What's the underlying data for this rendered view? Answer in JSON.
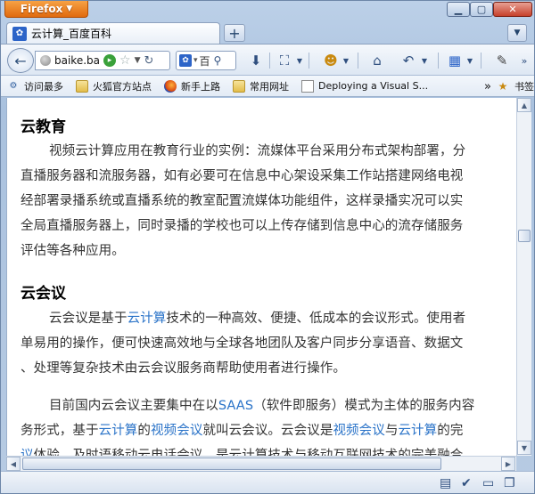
{
  "titlebar": {
    "app_button": "Firefox"
  },
  "tab": {
    "title": "云计算_百度百科",
    "favicon": "paw-icon"
  },
  "nav": {
    "url": "baike.ba",
    "search_text": "百"
  },
  "bookmarks": {
    "items": [
      "访问最多",
      "火狐官方站点",
      "新手上路",
      "常用网址",
      "Deploying a Visual S..."
    ],
    "more": "»",
    "bookmarks_label": "书签"
  },
  "content": {
    "section1": {
      "heading": "云教育",
      "lines": [
        "视频云计算应用在教育行业的实例：流媒体平台采用分布式架构部署，分",
        "直播服务器和流服务器，如有必要可在信息中心架设采集工作站搭建网络电视",
        "经部署录播系统或直播系统的教室配置流媒体功能组件，这样录播实况可以实",
        "全局直播服务器上，同时录播的学校也可以上传存储到信息中心的流存储服务",
        "评估等各种应用。"
      ]
    },
    "section2": {
      "heading": "云会议",
      "p1": {
        "l1_a": "云会议是基于",
        "l1_link": "云计算",
        "l1_b": "技术的一种高效、便捷、低成本的会议形式。使用者",
        "l2": "单易用的操作，便可快速高效地与全球各地团队及客户同步分享语音、数据文",
        "l3": "、处理等复杂技术由云会议服务商帮助使用者进行操作。"
      },
      "p2": {
        "l1_a": "目前国内云会议主要集中在以",
        "l1_link": "SAAS",
        "l1_b": "（软件即服务）模式为主体的服务内容",
        "l2_a": "务形式，基于",
        "l2_link1": "云计算",
        "l2_b": "的",
        "l2_link2": "视频会议",
        "l2_c": "就叫云会议。云会议是",
        "l2_link3": "视频会议",
        "l2_d": "与",
        "l2_link4": "云计算",
        "l2_e": "的完",
        "l3_link": "议",
        "l3_b": "体验。及时语移动云电话会议，是云计算技术与移动互联网技术的完美融合"
      }
    }
  }
}
